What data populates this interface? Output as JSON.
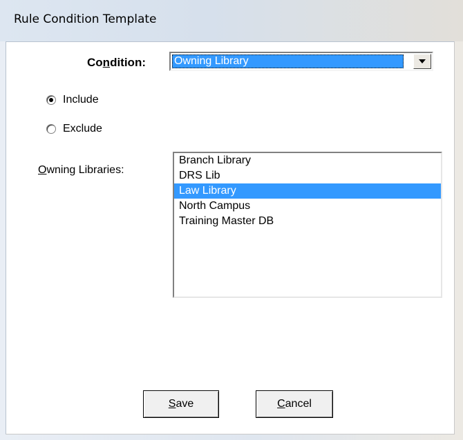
{
  "window": {
    "title": "Rule Condition Template"
  },
  "condition": {
    "label_prefix": "Co",
    "label_mnemonic": "n",
    "label_suffix": "dition:",
    "selected": "Owning Library"
  },
  "radios": {
    "include": {
      "label": "Include",
      "checked": true
    },
    "exclude": {
      "label": "Exclude",
      "checked": false
    }
  },
  "owning": {
    "label_mnemonic": "O",
    "label_suffix": "wning Libraries:",
    "items": [
      "Branch Library",
      "DRS Lib",
      "Law Library",
      "North Campus",
      "Training Master DB"
    ],
    "selected_index": 2
  },
  "buttons": {
    "save_mnemonic": "S",
    "save_suffix": "ave",
    "cancel_mnemonic": "C",
    "cancel_suffix": "ancel"
  },
  "colors": {
    "selection": "#3399ff",
    "face": "#f0f0f0"
  }
}
